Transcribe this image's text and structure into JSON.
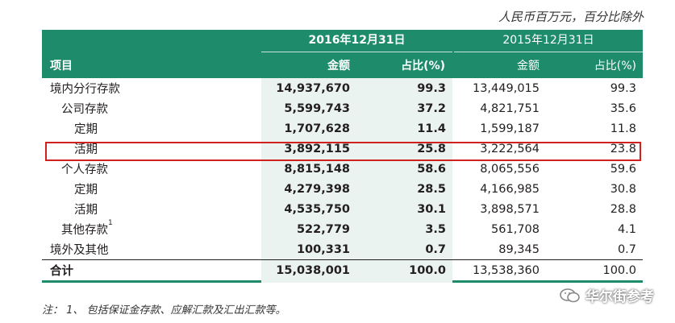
{
  "unit_note": "人民币百万元，百分比除外",
  "header": {
    "year_2016": "2016年12月31日",
    "year_2015": "2015年12月31日",
    "item": "项目",
    "amount": "金额",
    "percent": "占比(%)"
  },
  "rows": [
    {
      "item": "境内分行存款",
      "amt16": "14,937,670",
      "pct16": "99.3",
      "amt15": "13,449,015",
      "pct15": "99.3"
    },
    {
      "item": "公司存款",
      "amt16": "5,599,743",
      "pct16": "37.2",
      "amt15": "4,821,751",
      "pct15": "35.6"
    },
    {
      "item": "定期",
      "amt16": "1,707,628",
      "pct16": "11.4",
      "amt15": "1,599,187",
      "pct15": "11.8"
    },
    {
      "item": "活期",
      "amt16": "3,892,115",
      "pct16": "25.8",
      "amt15": "3,222,564",
      "pct15": "23.8"
    },
    {
      "item": "个人存款",
      "amt16": "8,815,148",
      "pct16": "58.6",
      "amt15": "8,065,556",
      "pct15": "59.6"
    },
    {
      "item": "定期",
      "amt16": "4,279,398",
      "pct16": "28.5",
      "amt15": "4,166,985",
      "pct15": "30.8"
    },
    {
      "item": "活期",
      "amt16": "4,535,750",
      "pct16": "30.1",
      "amt15": "3,898,571",
      "pct15": "28.8"
    },
    {
      "item": "其他存款",
      "sup": "1",
      "amt16": "522,779",
      "pct16": "3.5",
      "amt15": "561,708",
      "pct15": "4.1"
    },
    {
      "item": "境外及其他",
      "amt16": "100,331",
      "pct16": "0.7",
      "amt15": "89,345",
      "pct15": "0.7"
    },
    {
      "item": "合计",
      "amt16": "15,038,001",
      "pct16": "100.0",
      "amt15": "13,538,360",
      "pct15": "100.0"
    }
  ],
  "footnote": "注： 1、 包括保证金存款、应解汇款及汇出汇款等。",
  "watermark": "华尔街参考",
  "colors": {
    "header_bg": "#1e8c6a",
    "highlight_border": "#d02020",
    "shade": "#eaf3ef"
  }
}
